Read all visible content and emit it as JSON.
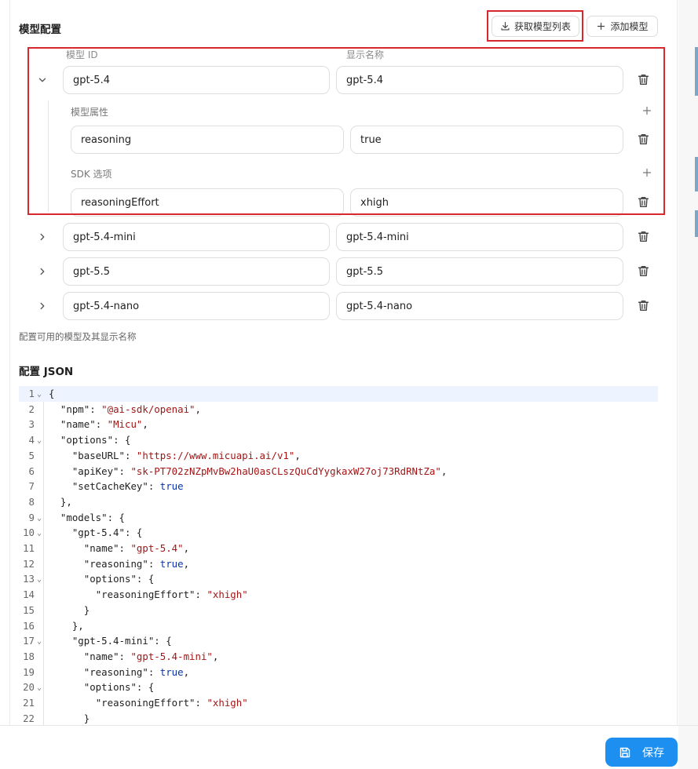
{
  "section": {
    "models_title": "模型配置",
    "fetch_label": "获取模型列表",
    "add_label": "添加模型",
    "col_id": "模型 ID",
    "col_name": "显示名称",
    "hint": "配置可用的模型及其显示名称",
    "json_title": "配置 JSON"
  },
  "expanded_model": {
    "id": "gpt-5.4",
    "name": "gpt-5.4",
    "attr_title": "模型属性",
    "attr_key": "reasoning",
    "attr_value": "true",
    "sdk_title": "SDK 选项",
    "sdk_key": "reasoningEffort",
    "sdk_value": "xhigh"
  },
  "collapsed_models": [
    {
      "id": "gpt-5.4-mini",
      "name": "gpt-5.4-mini"
    },
    {
      "id": "gpt-5.5",
      "name": "gpt-5.5"
    },
    {
      "id": "gpt-5.4-nano",
      "name": "gpt-5.4-nano"
    }
  ],
  "code_lines": [
    {
      "n": "1",
      "fold": true,
      "parts": [
        [
          "p",
          "{"
        ]
      ]
    },
    {
      "n": "2",
      "fold": false,
      "parts": [
        [
          "p",
          "  "
        ],
        [
          "k",
          "\"npm\""
        ],
        [
          "p",
          ": "
        ],
        [
          "s",
          "\"@ai-sdk/openai\""
        ],
        [
          "p",
          ","
        ]
      ]
    },
    {
      "n": "3",
      "fold": false,
      "parts": [
        [
          "p",
          "  "
        ],
        [
          "k",
          "\"name\""
        ],
        [
          "p",
          ": "
        ],
        [
          "s",
          "\"Micu\""
        ],
        [
          "p",
          ","
        ]
      ]
    },
    {
      "n": "4",
      "fold": true,
      "parts": [
        [
          "p",
          "  "
        ],
        [
          "k",
          "\"options\""
        ],
        [
          "p",
          ": {"
        ]
      ]
    },
    {
      "n": "5",
      "fold": false,
      "parts": [
        [
          "p",
          "    "
        ],
        [
          "k",
          "\"baseURL\""
        ],
        [
          "p",
          ": "
        ],
        [
          "s",
          "\"https://www.micuapi.ai/v1\""
        ],
        [
          "p",
          ","
        ]
      ]
    },
    {
      "n": "6",
      "fold": false,
      "parts": [
        [
          "p",
          "    "
        ],
        [
          "k",
          "\"apiKey\""
        ],
        [
          "p",
          ": "
        ],
        [
          "s",
          "\"sk-PT702zNZpMvBw2haU0asCLszQuCdYygkaxW27oj73RdRNtZa\""
        ],
        [
          "p",
          ","
        ]
      ]
    },
    {
      "n": "7",
      "fold": false,
      "parts": [
        [
          "p",
          "    "
        ],
        [
          "k",
          "\"setCacheKey\""
        ],
        [
          "p",
          ": "
        ],
        [
          "b",
          "true"
        ]
      ]
    },
    {
      "n": "8",
      "fold": false,
      "parts": [
        [
          "p",
          "  },"
        ]
      ]
    },
    {
      "n": "9",
      "fold": true,
      "parts": [
        [
          "p",
          "  "
        ],
        [
          "k",
          "\"models\""
        ],
        [
          "p",
          ": {"
        ]
      ]
    },
    {
      "n": "10",
      "fold": true,
      "parts": [
        [
          "p",
          "    "
        ],
        [
          "k",
          "\"gpt-5.4\""
        ],
        [
          "p",
          ": {"
        ]
      ]
    },
    {
      "n": "11",
      "fold": false,
      "parts": [
        [
          "p",
          "      "
        ],
        [
          "k",
          "\"name\""
        ],
        [
          "p",
          ": "
        ],
        [
          "s",
          "\"gpt-5.4\""
        ],
        [
          "p",
          ","
        ]
      ]
    },
    {
      "n": "12",
      "fold": false,
      "parts": [
        [
          "p",
          "      "
        ],
        [
          "k",
          "\"reasoning\""
        ],
        [
          "p",
          ": "
        ],
        [
          "b",
          "true"
        ],
        [
          "p",
          ","
        ]
      ]
    },
    {
      "n": "13",
      "fold": true,
      "parts": [
        [
          "p",
          "      "
        ],
        [
          "k",
          "\"options\""
        ],
        [
          "p",
          ": {"
        ]
      ]
    },
    {
      "n": "14",
      "fold": false,
      "parts": [
        [
          "p",
          "        "
        ],
        [
          "k",
          "\"reasoningEffort\""
        ],
        [
          "p",
          ": "
        ],
        [
          "s",
          "\"xhigh\""
        ]
      ]
    },
    {
      "n": "15",
      "fold": false,
      "parts": [
        [
          "p",
          "      }"
        ]
      ]
    },
    {
      "n": "16",
      "fold": false,
      "parts": [
        [
          "p",
          "    },"
        ]
      ]
    },
    {
      "n": "17",
      "fold": true,
      "parts": [
        [
          "p",
          "    "
        ],
        [
          "k",
          "\"gpt-5.4-mini\""
        ],
        [
          "p",
          ": {"
        ]
      ]
    },
    {
      "n": "18",
      "fold": false,
      "parts": [
        [
          "p",
          "      "
        ],
        [
          "k",
          "\"name\""
        ],
        [
          "p",
          ": "
        ],
        [
          "s",
          "\"gpt-5.4-mini\""
        ],
        [
          "p",
          ","
        ]
      ]
    },
    {
      "n": "19",
      "fold": false,
      "parts": [
        [
          "p",
          "      "
        ],
        [
          "k",
          "\"reasoning\""
        ],
        [
          "p",
          ": "
        ],
        [
          "b",
          "true"
        ],
        [
          "p",
          ","
        ]
      ]
    },
    {
      "n": "20",
      "fold": true,
      "parts": [
        [
          "p",
          "      "
        ],
        [
          "k",
          "\"options\""
        ],
        [
          "p",
          ": {"
        ]
      ]
    },
    {
      "n": "21",
      "fold": false,
      "parts": [
        [
          "p",
          "        "
        ],
        [
          "k",
          "\"reasoningEffort\""
        ],
        [
          "p",
          ": "
        ],
        [
          "s",
          "\"xhigh\""
        ]
      ]
    },
    {
      "n": "22",
      "fold": false,
      "parts": [
        [
          "p",
          "      }"
        ]
      ]
    }
  ],
  "save_label": "保存",
  "icons": {
    "fetch": "download-icon",
    "add": "plus-icon",
    "expand": "chevron-icon",
    "delete": "trash-icon",
    "save": "floppy-disk-icon"
  },
  "colors": {
    "accent": "#1d8ff0",
    "highlight_frame": "#d9272e",
    "json_string": "#a31515",
    "json_boolean": "#0b33a8"
  }
}
